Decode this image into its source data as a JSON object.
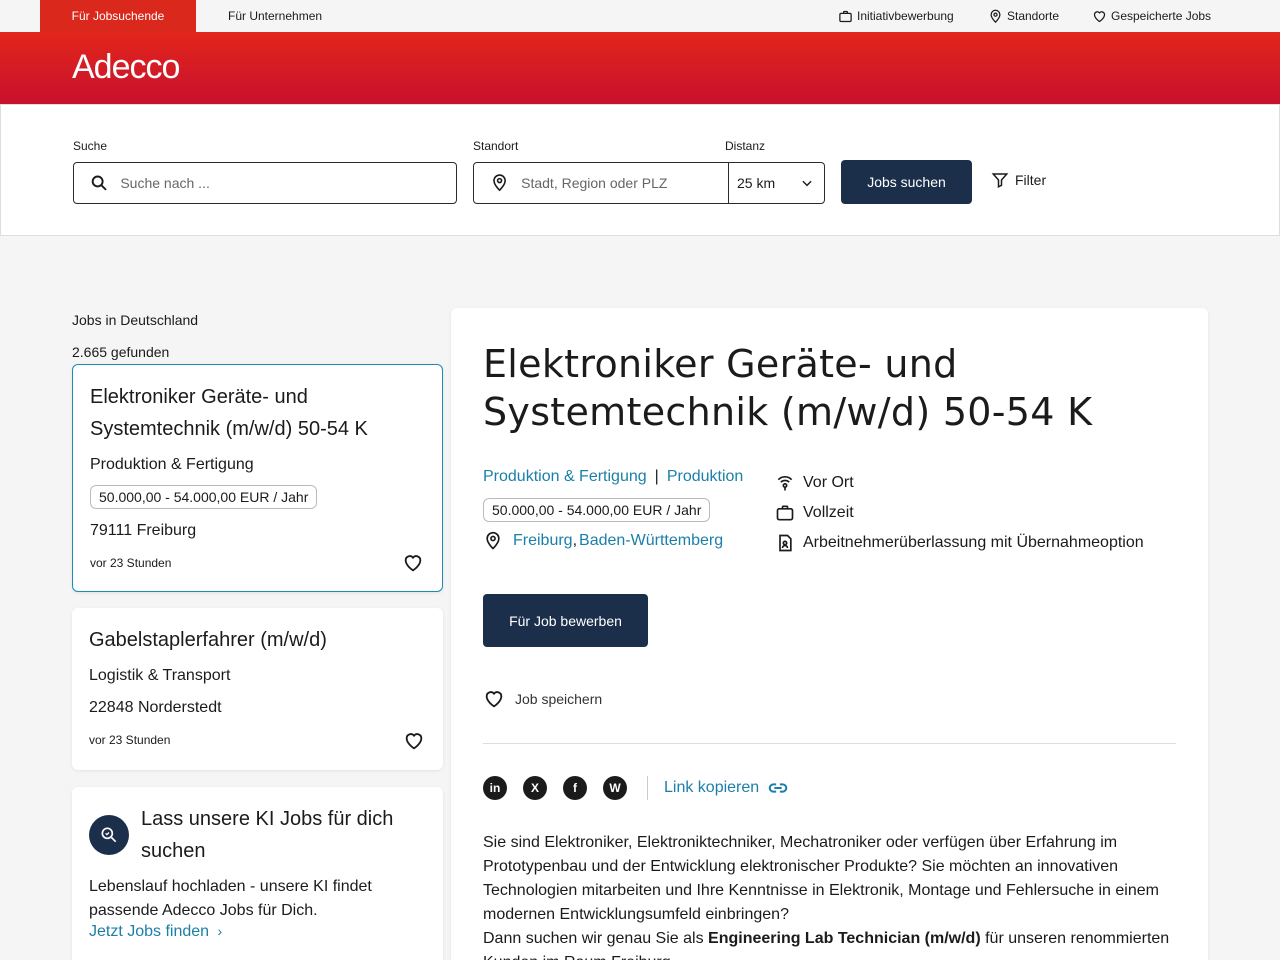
{
  "topbar": {
    "tab_jobseekers": "Für Jobsuchende",
    "tab_companies": "Für Unternehmen",
    "initiative": "Initiativbewerbung",
    "locations": "Standorte",
    "saved_jobs": "Gespeicherte Jobs"
  },
  "brand": {
    "logo": "Adecco",
    "color": "#da291c"
  },
  "search": {
    "query_label": "Suche",
    "query_placeholder": "Suche nach ...",
    "location_label": "Standort",
    "location_placeholder": "Stadt, Region oder PLZ",
    "distance_label": "Distanz",
    "distance_value": "25 km",
    "submit_label": "Jobs suchen",
    "filter_label": "Filter"
  },
  "results": {
    "title": "Jobs in Deutschland",
    "count": "2.665 gefunden",
    "items": [
      {
        "title": "Elektroniker Geräte- und Systemtechnik (m/w/d) 50-54 K",
        "category": "Produktion & Fertigung",
        "salary": "50.000,00 - 54.000,00 EUR / Jahr",
        "location": "79111 Freiburg",
        "posted": "vor 23 Stunden"
      },
      {
        "title": "Gabelstaplerfahrer (m/w/d)",
        "category": "Logistik & Transport",
        "location": "22848 Norderstedt",
        "posted": "vor 23 Stunden"
      }
    ]
  },
  "ai_promo": {
    "title": "Lass unsere KI Jobs für dich suchen",
    "text": "Lebenslauf hochladen - unsere KI findet passende Adecco Jobs für Dich.",
    "link": "Jetzt Jobs finden"
  },
  "detail": {
    "title": "Elektroniker Geräte- und Systemtechnik (m/w/d) 50-54 K",
    "category_1": "Produktion & Fertigung",
    "category_sep": "|",
    "category_2": "Produktion",
    "salary": "50.000,00 - 54.000,00 EUR / Jahr",
    "city": "Freiburg",
    "region": "Baden-Württemberg",
    "work_mode": "Vor Ort",
    "employment_type": "Vollzeit",
    "contract_type": "Arbeitnehmerüberlassung mit Übernahmeoption",
    "apply_label": "Für Job bewerben",
    "save_label": "Job speichern",
    "copy_link_label": "Link kopieren",
    "share": {
      "linkedin": "in",
      "x": "X",
      "facebook": "f",
      "whatsapp": "W"
    },
    "description_p1": "Sie sind Elektroniker, Elektroniktechniker, Mechatroniker oder verfügen über Erfahrung im Prototypenbau und der Entwicklung elektronischer Produkte? Sie möchten an innovativen Technologien mitarbeiten und Ihre Kenntnisse in Elektronik, Montage und Fehlersuche in einem modernen Entwicklungsumfeld einbringen?",
    "description_p2_pre": "Dann suchen wir genau Sie als ",
    "description_p2_bold": "Engineering Lab Technician (m/w/d)",
    "description_p2_post": " für unseren renommierten Kunden im Raum Freiburg."
  }
}
